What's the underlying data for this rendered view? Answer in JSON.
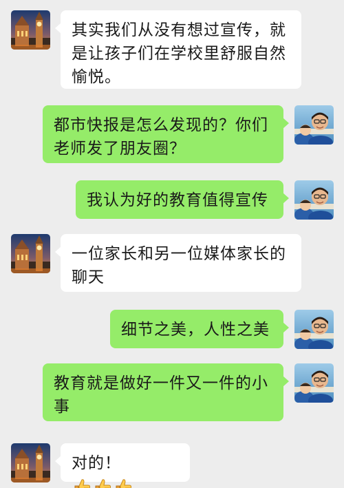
{
  "conversation": {
    "messages": [
      {
        "side": "left",
        "avatar": "big-ben-avatar",
        "text": "其实我们从没有想过宣传，就是让孩子们在学校里舒服自然愉悦。"
      },
      {
        "side": "right",
        "avatar": "man-photo-avatar",
        "text": "都市快报是怎么发现的？你们老师发了朋友圈？"
      },
      {
        "side": "right",
        "avatar": "man-photo-avatar",
        "text": "我认为好的教育值得宣传"
      },
      {
        "side": "left",
        "avatar": "big-ben-avatar",
        "text": "一位家长和另一位媒体家长的聊天"
      },
      {
        "side": "right",
        "avatar": "man-photo-avatar",
        "text": "细节之美，人性之美"
      },
      {
        "side": "right",
        "avatar": "man-photo-avatar",
        "text": "教育就是做好一件又一件的小事"
      },
      {
        "side": "left",
        "avatar": "big-ben-avatar",
        "text": "对的！",
        "emoji": [
          "thumbs-up-icon",
          "thumbs-up-icon",
          "thumbs-up-icon"
        ]
      }
    ]
  },
  "colors": {
    "background": "#ededed",
    "incoming_bubble": "#ffffff",
    "outgoing_bubble": "#95ec69",
    "text": "#1a1a1a"
  }
}
